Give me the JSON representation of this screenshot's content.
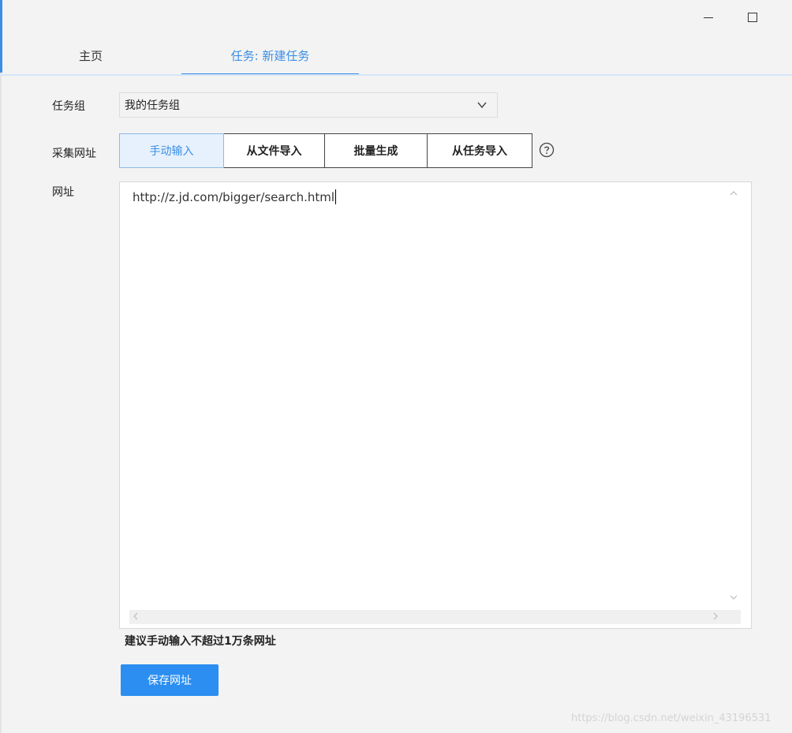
{
  "window": {
    "minimize_icon": "minimize-icon",
    "maximize_icon": "maximize-icon"
  },
  "tabs": [
    {
      "label": "主页",
      "active": false
    },
    {
      "label": "任务: 新建任务",
      "active": true
    }
  ],
  "form": {
    "group_label": "任务组",
    "group_value": "我的任务组",
    "url_mode_label": "采集网址",
    "url_modes": [
      "手动输入",
      "从文件导入",
      "批量生成",
      "从任务导入"
    ],
    "selected_mode": "手动输入",
    "url_label": "网址",
    "url_value": "http://z.jd.com/bigger/search.html",
    "hint": "建议手动输入不超过1万条网址",
    "save_label": "保存网址"
  },
  "watermark": "https://blog.csdn.net/weixin_43196531",
  "colors": {
    "accent": "#3a8ee6",
    "save_button": "#2b8ef0",
    "background": "#f3f3f3"
  }
}
